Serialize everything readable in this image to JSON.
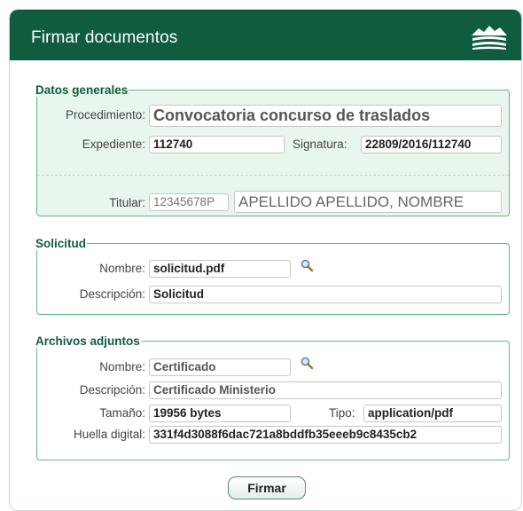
{
  "window": {
    "title": "Firmar documentos"
  },
  "datos_generales": {
    "legend": "Datos generales",
    "procedimiento": {
      "label": "Procedimiento:",
      "value": "Convocatoria concurso de traslados"
    },
    "expediente": {
      "label": "Expediente:",
      "value": "112740"
    },
    "signatura": {
      "label": "Signatura:",
      "value": "22809/2016/112740"
    },
    "titular": {
      "label": "Titular:",
      "id": "12345678P",
      "name": "APELLIDO APELLIDO, NOMBRE"
    }
  },
  "solicitud": {
    "legend": "Solicitud",
    "nombre": {
      "label": "Nombre:",
      "value": "solicitud.pdf"
    },
    "descripcion": {
      "label": "Descripción:",
      "value": "Solicitud"
    }
  },
  "archivos_adjuntos": {
    "legend": "Archivos adjuntos",
    "nombre": {
      "label": "Nombre:",
      "value": "Certificado"
    },
    "descripcion": {
      "label": "Descripción:",
      "value": "Certificado Ministerio"
    },
    "tamano": {
      "label": "Tamaño:",
      "value": "19956  bytes"
    },
    "tipo": {
      "label": "Tipo:",
      "value": "application/pdf"
    },
    "huella": {
      "label": "Huella digital:",
      "value": "331f4d3088f6dac721a8bddfb35eeeb9c8435cb2"
    }
  },
  "actions": {
    "firmar_label": "Firmar"
  },
  "icons": {
    "logo": "junta-logo-icon",
    "search": "magnifier-icon"
  },
  "colors": {
    "header": "#0f5c3f",
    "border": "#67b584",
    "panel": "#e9f6ee"
  }
}
